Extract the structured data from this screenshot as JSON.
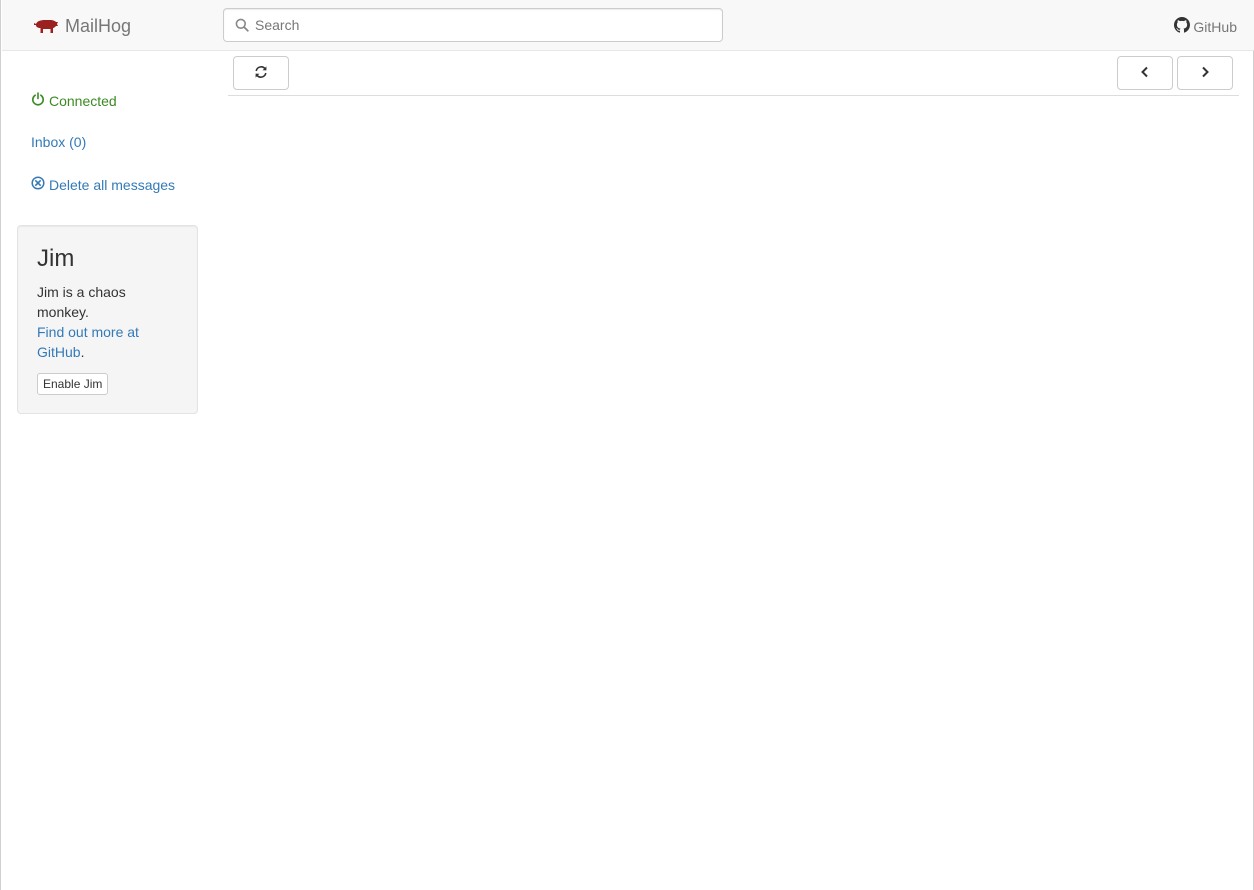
{
  "navbar": {
    "brand": "MailHog",
    "search": {
      "placeholder": "Search",
      "value": ""
    },
    "github": "GitHub"
  },
  "sidebar": {
    "connected": "Connected",
    "inbox": "Inbox (0)",
    "delete_all": "Delete all messages"
  },
  "jim": {
    "title": "Jim",
    "description": "Jim is a chaos monkey.",
    "link_text": "Find out more at GitHub",
    "link_suffix": ".",
    "button": "Enable Jim"
  },
  "icons": {
    "logo": "pig-icon",
    "search": "search-icon",
    "github": "github-icon",
    "connected": "power-icon",
    "delete": "circle-x-icon",
    "refresh": "refresh-icon",
    "prev": "chevron-left-icon",
    "next": "chevron-right-icon"
  },
  "colors": {
    "link": "#337ab7",
    "connected": "#3c8a24",
    "logo": "#9b2020",
    "navbar_bg": "#f8f8f8"
  }
}
